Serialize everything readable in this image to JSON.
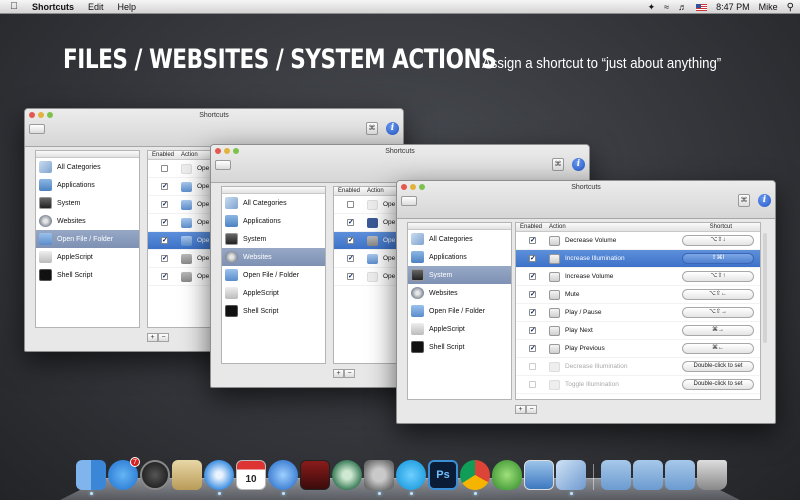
{
  "menubar": {
    "app_name": "Shortcuts",
    "menus": [
      "Edit",
      "Help"
    ],
    "time": "8:47 PM",
    "user": "Mike"
  },
  "headline": "FILES / WEBSITES / SYSTEM ACTIONS",
  "tagline": "Assign a shortcut to “just about anything”",
  "window_title": "Shortcuts",
  "categories": [
    "All Categories",
    "Applications",
    "System",
    "Websites",
    "Open File / Folder",
    "AppleScript",
    "Shell Script"
  ],
  "columns": {
    "enabled": "Enabled",
    "action": "Action",
    "shortcut": "Shortcut"
  },
  "window1": {
    "selected_category": "Open File / Folder",
    "rows": [
      {
        "checked": false,
        "action": "Ope"
      },
      {
        "checked": true,
        "action": "Ope"
      },
      {
        "checked": true,
        "action": "Ope"
      },
      {
        "checked": true,
        "action": "Ope"
      },
      {
        "checked": true,
        "action": "Ope",
        "selected": true
      },
      {
        "checked": true,
        "action": "Ope"
      },
      {
        "checked": true,
        "action": "Ope"
      }
    ]
  },
  "window2": {
    "selected_category": "Websites",
    "rows": [
      {
        "checked": false,
        "action": "Ope"
      },
      {
        "checked": true,
        "action": "Ope"
      },
      {
        "checked": true,
        "action": "Ope",
        "selected": true
      },
      {
        "checked": true,
        "action": "Ope"
      },
      {
        "checked": true,
        "action": "Ope"
      }
    ]
  },
  "window3": {
    "selected_category": "System",
    "rows": [
      {
        "checked": true,
        "action": "Decrease Volume",
        "shortcut": "⌥⇧↓"
      },
      {
        "checked": true,
        "action": "Increase Illumination",
        "shortcut": "⇧⌘I",
        "selected": true
      },
      {
        "checked": true,
        "action": "Increase Volume",
        "shortcut": "⌥⇧↑"
      },
      {
        "checked": true,
        "action": "Mute",
        "shortcut": "⌥⇧←"
      },
      {
        "checked": true,
        "action": "Play / Pause",
        "shortcut": "⌥⇧→"
      },
      {
        "checked": true,
        "action": "Play Next",
        "shortcut": "⌘→"
      },
      {
        "checked": true,
        "action": "Play Previous",
        "shortcut": "⌘←"
      },
      {
        "checked": false,
        "action": "Decrease Illumination",
        "shortcut": "Double-click to set",
        "dim": true
      },
      {
        "checked": false,
        "action": "Toggle Illumination",
        "shortcut": "Double-click to set",
        "dim": true
      }
    ]
  },
  "plus_minus": [
    "+",
    "−"
  ],
  "dock": {
    "app_store_badge": "7",
    "calendar_day": "10"
  }
}
